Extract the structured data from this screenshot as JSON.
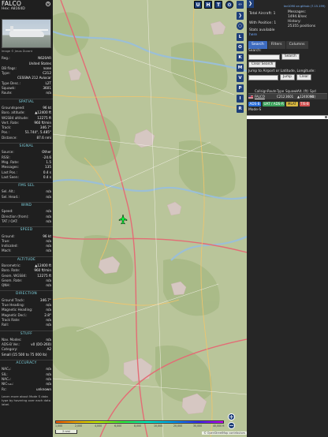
{
  "aircraft": {
    "callsign": "FALCO",
    "hex_label": "Hex:",
    "hex": "A8164D",
    "photo_credit": "Image © Jesus Durant"
  },
  "details_top": [
    {
      "k": "Reg.:",
      "v": "N620AR"
    },
    {
      "k": "",
      "v": "United States"
    },
    {
      "k": "DB flags:",
      "v": "none"
    },
    {
      "k": "Type:",
      "v": "C212"
    }
  ],
  "type_desc_name": "CESSNA 212 Aviocar",
  "details_mid": [
    {
      "k": "Type Desc.:",
      "v": "L2T"
    },
    {
      "k": "Squawk:",
      "v": "3601"
    },
    {
      "k": "Route:",
      "v": "n/a"
    }
  ],
  "sections": {
    "spatial": "SPATIAL",
    "signal": "SIGNAL",
    "fms": "FMS SEL",
    "wind": "WIND",
    "speed": "SPEED",
    "altitude": "ALTITUDE",
    "direction": "DIRECTION",
    "stuff": "STUFF",
    "accuracy": "ACCURACY"
  },
  "spatial": [
    {
      "k": "Groundspeed:",
      "v": "96 kt"
    },
    {
      "k": "Baro. altitude:",
      "v": "▲12400 ft"
    },
    {
      "k": "WGS84 altitude:",
      "v": "12275 ft"
    },
    {
      "k": "Vert. Rate:",
      "v": "960 ft/min"
    },
    {
      "k": "Track:",
      "v": "346.7°"
    },
    {
      "k": "Pos.:",
      "v": "51.744°, 5.485°"
    },
    {
      "k": "Distance:",
      "v": "87.6 nmi"
    }
  ],
  "signal": [
    {
      "k": "Source:",
      "v": "Other"
    },
    {
      "k": "RSSI:",
      "v": "-24.6"
    },
    {
      "k": "Msg. Rate:",
      "v": "1.5"
    },
    {
      "k": "Messages:",
      "v": "135"
    },
    {
      "k": "Last Pos.:",
      "v": "0.4 s"
    },
    {
      "k": "Last Seen:",
      "v": "0.4 s"
    }
  ],
  "fms": [
    {
      "k": "Sel. Alt.:",
      "v": "n/a"
    },
    {
      "k": "Sel. Head.:",
      "v": "n/a"
    }
  ],
  "wind": [
    {
      "k": "Speed:",
      "v": "n/a"
    },
    {
      "k": "Direction (from):",
      "v": "n/a"
    },
    {
      "k": "TAT / OAT:",
      "v": "n/a"
    }
  ],
  "speed": [
    {
      "k": "Ground:",
      "v": "96 kt"
    },
    {
      "k": "True:",
      "v": "n/a"
    },
    {
      "k": "Indicated:",
      "v": "n/a"
    },
    {
      "k": "Mach:",
      "v": "n/a"
    }
  ],
  "altitude": [
    {
      "k": "Barometric:",
      "v": "▲12400 ft"
    },
    {
      "k": "Baro. Rate:",
      "v": "960 ft/min"
    },
    {
      "k": "Geom. WGS84:",
      "v": "12275 ft"
    },
    {
      "k": "Geom. Rate:",
      "v": "n/a"
    },
    {
      "k": "QNH:",
      "v": "n/a"
    }
  ],
  "direction": [
    {
      "k": "Ground Track:",
      "v": "346.7°"
    },
    {
      "k": "True Heading:",
      "v": "n/a"
    },
    {
      "k": "Magnetic Heading:",
      "v": "n/a"
    },
    {
      "k": "Magnetic Decl.:",
      "v": "2.8°"
    },
    {
      "k": "Track Rate:",
      "v": "n/a"
    },
    {
      "k": "Roll:",
      "v": "n/a"
    }
  ],
  "stuff": [
    {
      "k": "Nav. Modes:",
      "v": "n/a"
    },
    {
      "k": "ADS-B Ver.:",
      "v": "v0 (DO-260)"
    },
    {
      "k": "Category:",
      "v": "A2"
    }
  ],
  "category_desc": "Small (15 500 to 75 000 lb)",
  "accuracy": [
    {
      "k": "NACₚ:",
      "v": "n/a"
    },
    {
      "k": "SIL:",
      "v": "n/a"
    },
    {
      "k": "NACᵥ:",
      "v": "n/a"
    },
    {
      "k": "NIC₇ₐ₂ₒ:",
      "v": "n/a"
    },
    {
      "k": "Rᴄ:",
      "v": "unknown"
    }
  ],
  "footer_text": "Learn more about Mode S data type by hovering over each data label.",
  "map": {
    "top_buttons": [
      "U",
      "H",
      "T"
    ],
    "side_buttons": [
      "L",
      "O",
      "K",
      "M",
      "V",
      "P",
      "I",
      "R"
    ],
    "zoom_in": "+",
    "zoom_out": "−",
    "legend_labels": [
      "1,000",
      "2,000",
      "4,000",
      "6,000",
      "8,000",
      "10,000",
      "20,000",
      "30,000",
      "40,000 ft"
    ],
    "scale_label": "2 nmi",
    "attribution": "© OpenStreetMap contributors",
    "colors": {
      "water": "#9bbfd6",
      "forest": "#a8b985",
      "urban": "#d6c7c2",
      "road": "#e36c75"
    }
  },
  "rightpanel": {
    "expand_icon": "❯",
    "version": "tar1090 on github (7.15.199)",
    "total_aircraft_label": "Total Aircraft:",
    "total_aircraft": "1",
    "with_position_label": "With Position:",
    "with_position": "1",
    "messages_label": "Messages:",
    "messages_rate": "1494.8/sec",
    "history_label": "History:",
    "history": "25355 positions",
    "stats_label": "Stats available",
    "stats_link": "here",
    "tabs": [
      "Search",
      "Filters",
      "Columns"
    ],
    "search_label": "Search:",
    "search_button": "Search",
    "clear_search": "Clear Search",
    "jump_label": "Jump to Airport or Latitude, Longitude:",
    "jump_button": "Jump",
    "clear_button": "Clear",
    "columns": [
      "",
      "Callsign",
      "Route",
      "Type",
      "Squawk",
      "Alt. (ft)",
      "Spd (kt)"
    ],
    "rows": [
      {
        "flag": "us-flag",
        "callsign": "FALCO",
        "route": "",
        "type": "C212",
        "squawk": "3601",
        "alt": "▲12400",
        "spd": "96"
      }
    ],
    "sources": [
      {
        "label": "ADS-B",
        "bg": "#2a6fdb",
        "fg": "#ffffff"
      },
      {
        "label": "UAT / ADS-R",
        "bg": "#3aa05a",
        "fg": "#ffffff"
      },
      {
        "label": "MLAT",
        "bg": "#d9b840",
        "fg": "#1a1a1a"
      },
      {
        "label": "TIS-B",
        "bg": "#d05050",
        "fg": "#ffffff"
      }
    ],
    "modes_label": "Mode-S"
  }
}
